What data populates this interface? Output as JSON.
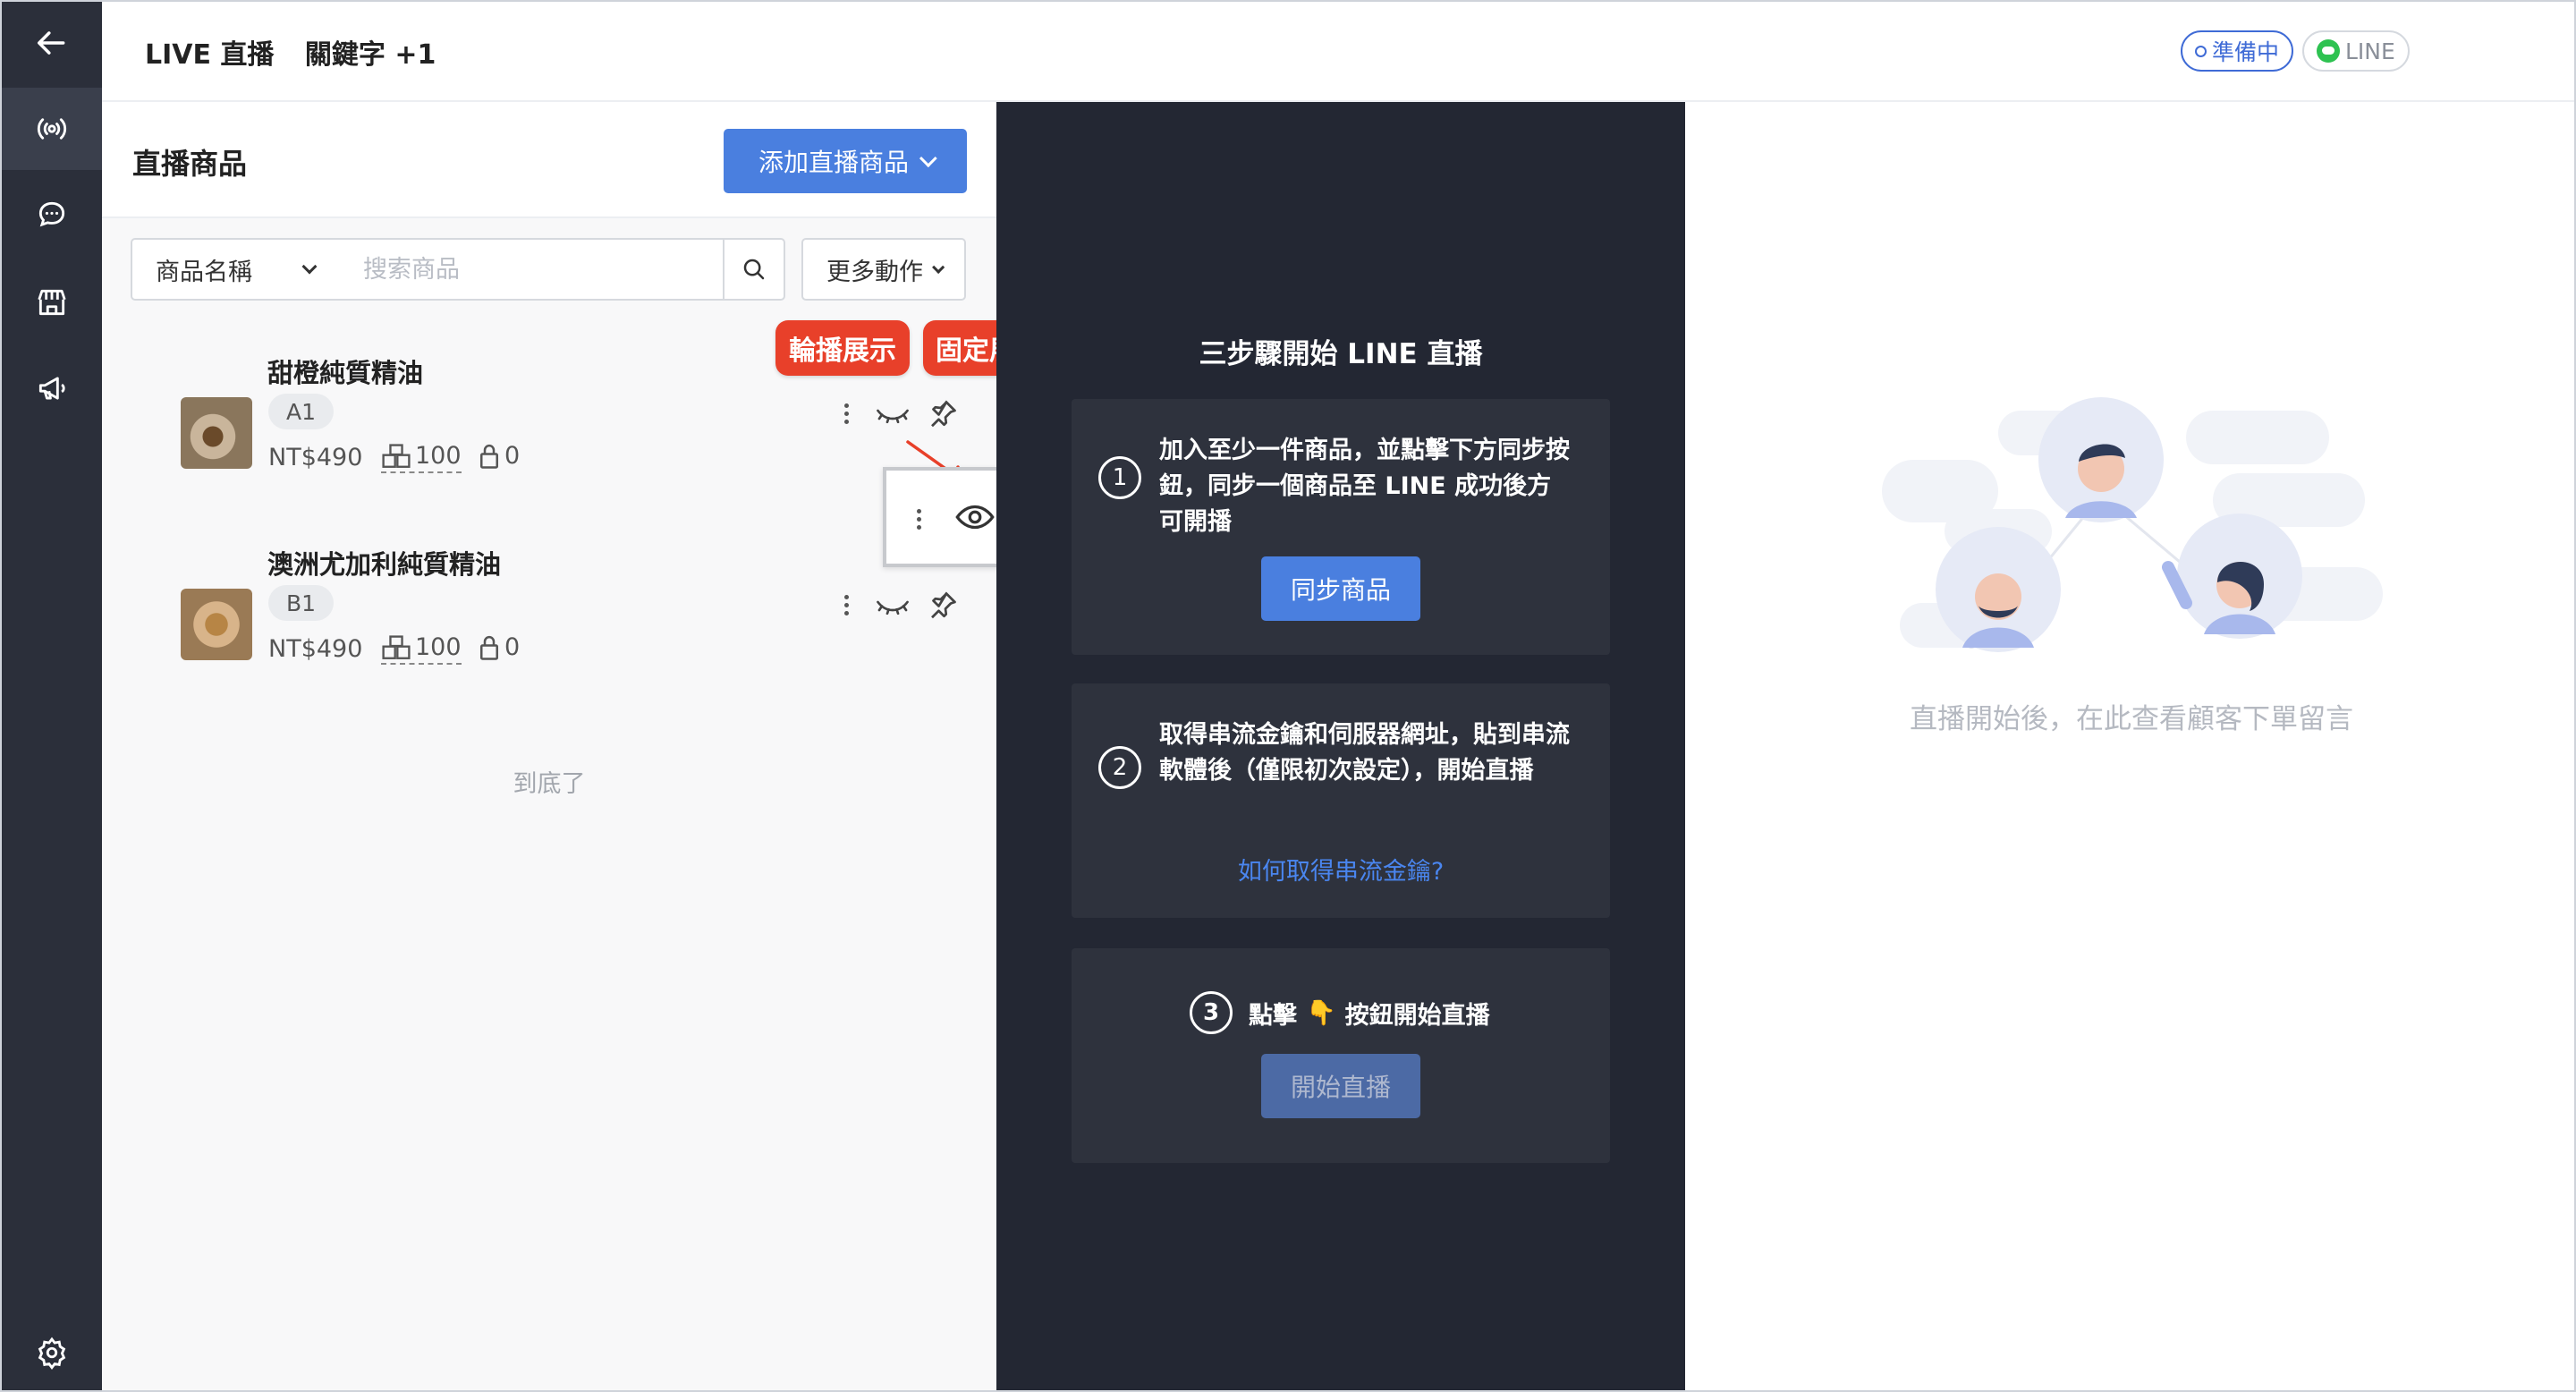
{
  "colors": {
    "nav_bg": "#2b2f3a",
    "primary": "#4a7fdf",
    "callout": "#e8402a",
    "dark_panel": "#232733",
    "card": "#2e323d",
    "link": "#4a86f0",
    "line_green": "#2ec251"
  },
  "nav": {
    "items": [
      {
        "icon": "arrow-left-icon"
      },
      {
        "icon": "broadcast-icon",
        "active": true
      },
      {
        "icon": "chat-bubble-icon"
      },
      {
        "icon": "shop-icon"
      },
      {
        "icon": "megaphone-icon"
      },
      {
        "icon": "gear-icon"
      }
    ]
  },
  "header": {
    "title": "LIVE 直播",
    "keyword": "關鍵字 +1",
    "status_badge": "準備中",
    "channel_badge": "LINE"
  },
  "products": {
    "title": "直播商品",
    "add_button": "添加直播商品",
    "select_value": "商品名稱",
    "search_placeholder": "搜索商品",
    "more_button": "更多動作",
    "items": [
      {
        "name": "甜橙純質精油",
        "code": "A1",
        "price": "NT$490",
        "stock": "100",
        "locked": "0"
      },
      {
        "name": "澳洲尤加利純質精油",
        "code": "B1",
        "price": "NT$490",
        "stock": "100",
        "locked": "0"
      }
    ],
    "end_text": "到底了"
  },
  "callouts": {
    "carousel": "輪播展示",
    "pinned": "固定展示"
  },
  "steps": {
    "title": "三步驟開始 LINE 直播",
    "step1": {
      "num": "1",
      "text": "加入至少一件商品，並點擊下方同步按鈕，同步一個商品至 LINE 成功後方可開播",
      "button": "同步商品"
    },
    "step2": {
      "num": "2",
      "text": "取得串流金鑰和伺服器網址，貼到串流軟體後（僅限初次設定），開始直播",
      "link": "如何取得串流金鑰?"
    },
    "step3": {
      "num": "3",
      "prefix": "點擊",
      "emoji": "👇",
      "suffix": "按鈕開始直播",
      "button": "開始直播"
    }
  },
  "comments": {
    "empty_text": "直播開始後，在此查看顧客下單留言"
  }
}
